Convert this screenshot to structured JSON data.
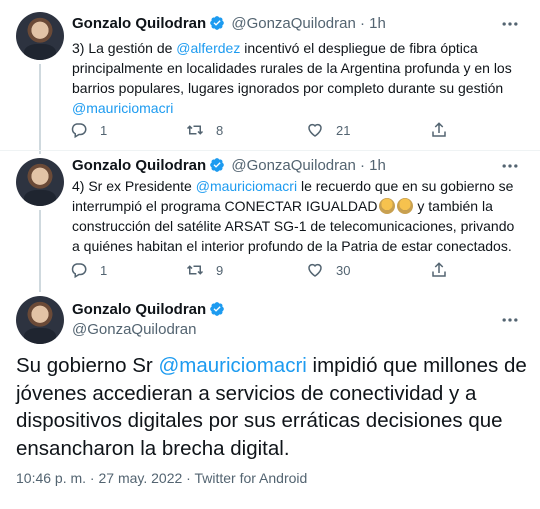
{
  "colors": {
    "accent": "#1d9bf0",
    "muted": "#536471",
    "text": "#0f1419"
  },
  "tweets": [
    {
      "author": "Gonzalo Quilodran",
      "handle": "@GonzaQuilodran",
      "time": "1h",
      "separator": "·",
      "text_parts": [
        {
          "t": "3) La gestión de "
        },
        {
          "t": "@alferdez",
          "mention": true
        },
        {
          "t": " incentivó el despliegue de fibra óptica principalmente en localidades rurales de la Argentina profunda y en los barrios populares, lugares ignorados por completo durante su gestión "
        },
        {
          "t": "@mauriciomacri",
          "mention": true
        }
      ],
      "replies": "1",
      "retweets": "8",
      "likes": "21"
    },
    {
      "author": "Gonzalo Quilodran",
      "handle": "@GonzaQuilodran",
      "time": "1h",
      "separator": "·",
      "text_parts": [
        {
          "t": "4) Sr ex Presidente "
        },
        {
          "t": "@mauriciomacri",
          "mention": true
        },
        {
          "t": " le recuerdo que en su gobierno se interrumpió el programa CONECTAR IGUALDAD"
        },
        {
          "emoji": "student-emoji"
        },
        {
          "emoji": "student-emoji"
        },
        {
          "t": " y también la construcción del satélite ARSAT SG-1 de telecomunicaciones, privando a quiénes habitan el interior profundo de la Patria de estar conectados."
        }
      ],
      "replies": "1",
      "retweets": "9",
      "likes": "30"
    }
  ],
  "main": {
    "author": "Gonzalo Quilodran",
    "handle": "@GonzaQuilodran",
    "text_parts": [
      {
        "t": "Su gobierno Sr "
      },
      {
        "t": "@mauriciomacri",
        "mention": true
      },
      {
        "t": " impidió que millones de jóvenes accedieran a servicios de conectividad y a dispositivos digitales por sus erráticas decisiones que ensancharon la brecha digital."
      }
    ],
    "timestamp": "10:46 p. m. · 27 may. 2022 · Twitter for Android"
  }
}
